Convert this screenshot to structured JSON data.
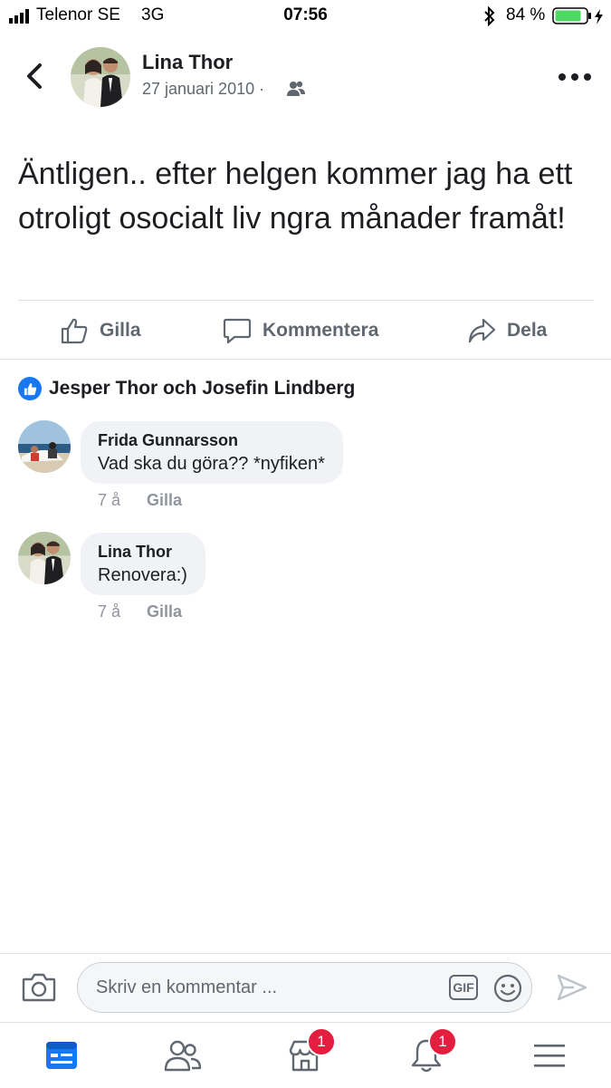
{
  "status_bar": {
    "carrier": "Telenor SE",
    "network": "3G",
    "time": "07:56",
    "battery": "84 %"
  },
  "post": {
    "author": "Lina Thor",
    "date": "27 januari 2010 ·",
    "text": "Äntligen.. efter helgen kommer jag ha ett otroligt osocialt liv ngra månader framåt!"
  },
  "actions": {
    "like": "Gilla",
    "comment": "Kommentera",
    "share": "Dela"
  },
  "likes": {
    "text": "Jesper Thor och Josefin Lindberg"
  },
  "comments": [
    {
      "author": "Frida Gunnarsson",
      "text": "Vad ska du göra?? *nyfiken*",
      "time": "7 å",
      "like_label": "Gilla"
    },
    {
      "author": "Lina Thor",
      "text": "Renovera:)",
      "time": "7 å",
      "like_label": "Gilla"
    }
  ],
  "composer": {
    "placeholder": "Skriv en kommentar ...",
    "gif_label": "GIF"
  },
  "tabbar": {
    "items": [
      "news-feed",
      "friends",
      "marketplace",
      "notifications",
      "menu"
    ],
    "marketplace_badge": "1",
    "notifications_badge": "1"
  },
  "colors": {
    "accent": "#1877f2",
    "badge": "#e41e3f",
    "muted": "#606770"
  }
}
